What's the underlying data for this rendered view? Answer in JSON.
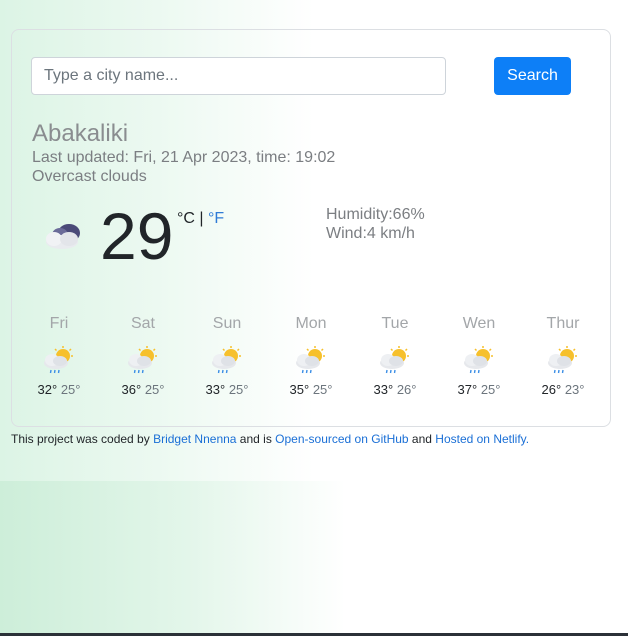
{
  "search": {
    "placeholder": "Type a city name...",
    "button_label": "Search"
  },
  "current": {
    "city": "Abakaliki",
    "last_updated": "Last updated: Fri, 21 Apr 2023, time: 19:02",
    "description": "Overcast clouds",
    "icon": "overcast-clouds-icon",
    "temperature": "29",
    "unit_celsius": "°C",
    "unit_separator": " | ",
    "unit_fahrenheit": "°F",
    "humidity": "Humidity:66%",
    "wind": "Wind:4 km/h"
  },
  "forecast": [
    {
      "day": "Fri",
      "max": "32°",
      "min": "25°",
      "icon": "sun-rain-cloud-icon"
    },
    {
      "day": "Sat",
      "max": "36°",
      "min": "25°",
      "icon": "sun-rain-cloud-icon"
    },
    {
      "day": "Sun",
      "max": "33°",
      "min": "25°",
      "icon": "sun-rain-cloud-icon"
    },
    {
      "day": "Mon",
      "max": "35°",
      "min": "25°",
      "icon": "sun-rain-cloud-icon"
    },
    {
      "day": "Tue",
      "max": "33°",
      "min": "26°",
      "icon": "sun-rain-cloud-icon"
    },
    {
      "day": "Wen",
      "max": "37°",
      "min": "25°",
      "icon": "sun-rain-cloud-icon"
    },
    {
      "day": "Thur",
      "max": "26°",
      "min": "23°",
      "icon": "sun-rain-cloud-icon"
    }
  ],
  "footer": {
    "prefix": "This project was coded by ",
    "author": "Bridget Nnenna",
    "middle": " and is ",
    "github": "Open-sourced on GitHub",
    "and": " and ",
    "netlify": "Hosted on Netlify."
  },
  "colors": {
    "accent": "#0d7ff7",
    "link": "#1a6fd6"
  }
}
